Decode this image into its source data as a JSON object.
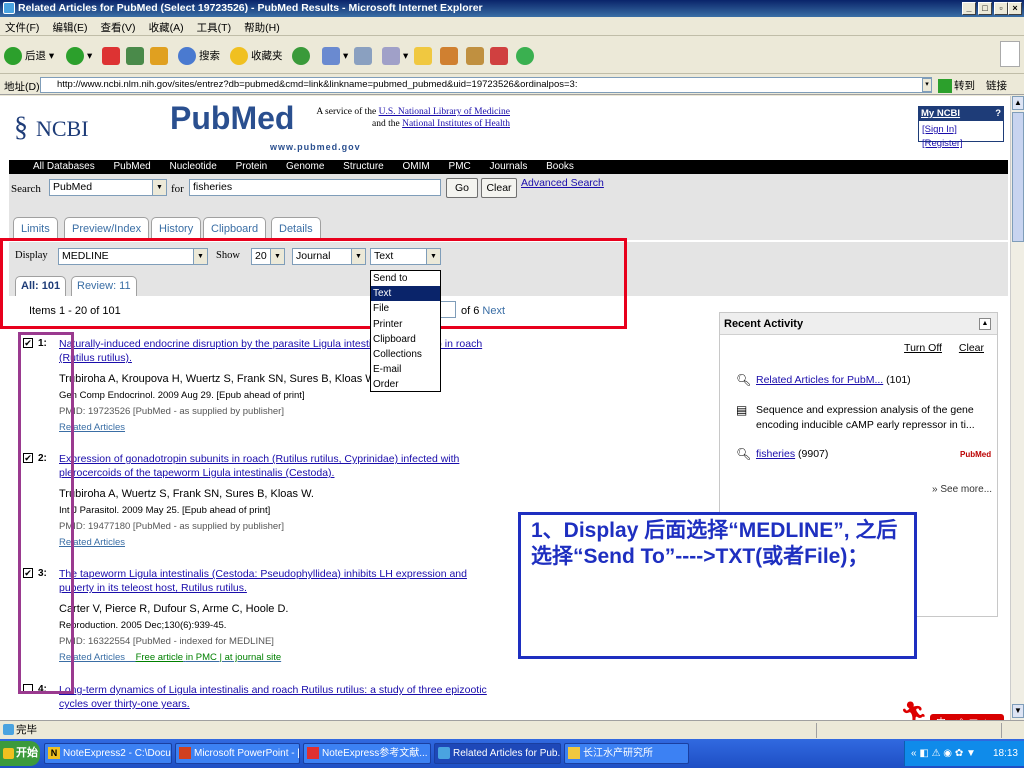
{
  "window": {
    "title": "Related Articles for PubMed (Select 19723526) - PubMed Results - Microsoft Internet Explorer"
  },
  "menu": [
    "文件(F)",
    "编辑(E)",
    "查看(V)",
    "收藏(A)",
    "工具(T)",
    "帮助(H)"
  ],
  "toolbar": {
    "back": "后退",
    "search": "搜索",
    "favorites": "收藏夹"
  },
  "address": {
    "label": "地址(D)",
    "url": "http://www.ncbi.nlm.nih.gov/sites/entrez?db=pubmed&cmd=link&linkname=pubmed_pubmed&uid=19723526&ordinalpos=3:",
    "go": "转到",
    "links": "链接"
  },
  "ncbi": {
    "logo": "NCBI",
    "pubmed_logo": "PubMed",
    "pubmed_url": "www.pubmed.gov",
    "service_line1": "A service of the",
    "service_link1": "U.S. National Library of Medicine",
    "service_line2": "and the",
    "service_link2": "National Institutes of Health",
    "my_ncbi": "My NCBI",
    "my_ncbi_help": "?",
    "sign_in": "[Sign In]",
    "register": "[Register]"
  },
  "databases": [
    "All Databases",
    "PubMed",
    "Nucleotide",
    "Protein",
    "Genome",
    "Structure",
    "OMIM",
    "PMC",
    "Journals",
    "Books"
  ],
  "search": {
    "label": "Search",
    "db": "PubMed",
    "for": "for",
    "query": "fisheries",
    "go": "Go",
    "clear": "Clear",
    "advanced": "Advanced Search"
  },
  "tabs": [
    "Limits",
    "Preview/Index",
    "History",
    "Clipboard",
    "Details"
  ],
  "display": {
    "label": "Display",
    "format": "MEDLINE",
    "show_label": "Show",
    "show_count": "20",
    "sort": "Journal",
    "send_to": "Text",
    "dropdown_options": [
      "Send to",
      "Text",
      "File",
      "Printer",
      "Clipboard",
      "Collections",
      "E-mail",
      "Order"
    ],
    "dropdown_selected": 1,
    "tab_all": "All: 101",
    "tab_review": "Review: 11",
    "items": "Items 1 - 20 of 101",
    "of_pages": "of 6",
    "next": "Next"
  },
  "results": [
    {
      "num": "1:",
      "checked": true,
      "title": "Naturally-induced endocrine disruption by the parasite Ligula intestinalis (Cestoda) in roach (Rutilus rutilus).",
      "authors": "Trubiroha A, Kroupova H, Wuertz S, Frank SN, Sures B, Kloas W.",
      "source": "Gen Comp Endocrinol. 2009 Aug 29. [Epub ahead of print]",
      "pmid": "PMID: 19723526 [PubMed - as supplied by publisher]",
      "related": "Related Articles",
      "free": "",
      "free_suffix": ""
    },
    {
      "num": "2:",
      "checked": true,
      "title": "Expression of gonadotropin subunits in roach (Rutilus rutilus, Cyprinidae) infected with plerocercoids of the tapeworm Ligula intestinalis (Cestoda).",
      "authors": "Trubiroha A, Wuertz S, Frank SN, Sures B, Kloas W.",
      "source": "Int J Parasitol. 2009 May 25. [Epub ahead of print]",
      "pmid": "PMID: 19477180 [PubMed - as supplied by publisher]",
      "related": "Related Articles",
      "free": "",
      "free_suffix": ""
    },
    {
      "num": "3:",
      "checked": true,
      "title": "The tapeworm Ligula intestinalis (Cestoda: Pseudophyllidea) inhibits LH expression and puberty in its teleost host, Rutilus rutilus.",
      "authors": "Carter V, Pierce R, Dufour S, Arme C, Hoole D.",
      "source": "Reproduction. 2005 Dec;130(6):939-45.",
      "pmid": "PMID: 16322554 [PubMed - indexed for MEDLINE]",
      "related": "Related Articles",
      "free": "Free article",
      "free_suffix": "in PMC | at journal site"
    },
    {
      "num": "4:",
      "checked": false,
      "title": "Long-term dynamics of Ligula intestinalis and roach Rutilus rutilus: a study of three epizootic cycles over thirty-one years.",
      "authors": "",
      "source": "",
      "pmid": "",
      "related": "",
      "free": "",
      "free_suffix": ""
    }
  ],
  "recent_activity": {
    "header": "Recent Activity",
    "turn_off": "Turn Off",
    "clear": "Clear",
    "items": [
      {
        "link": "Related Articles for PubM...",
        "suffix": "(101)"
      },
      {
        "link": "",
        "suffix": "Sequence and expression analysis of the gene encoding inducible cAMP early repressor in ti..."
      },
      {
        "link": "fisheries",
        "suffix": "(9907)"
      }
    ],
    "pubmed_tag": "PubMed",
    "see_more": "» See more..."
  },
  "annotation": {
    "text": "1、Display 后面选择“MEDLINE”, 之后选择“Send To”---->TXT(或者File)；"
  },
  "status": "完毕",
  "taskbar": {
    "start": "开始",
    "tasks": [
      "NoteExpress2 - C:\\Docu...",
      "Microsoft PowerPoint - [...",
      "NoteExpress参考文献...",
      "Related Articles for Pub...",
      "长江水产研究所"
    ],
    "active_index": 3,
    "clock": "18:13"
  }
}
